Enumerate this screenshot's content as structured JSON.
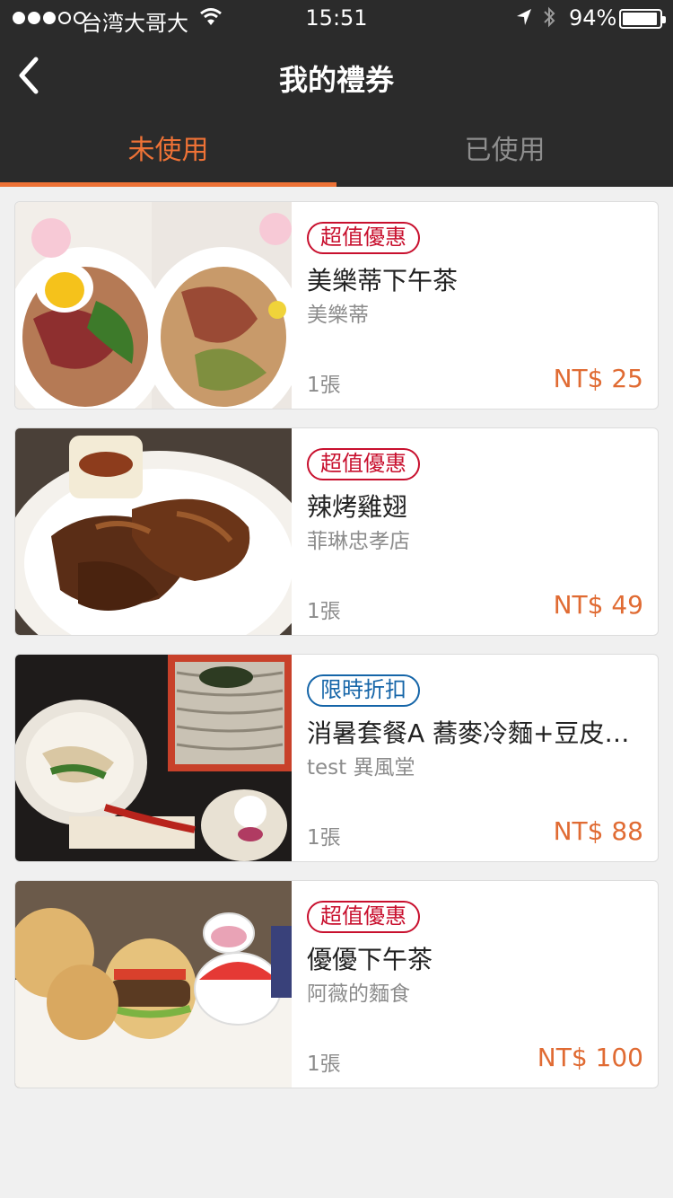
{
  "status_bar": {
    "carrier": "台湾大哥大",
    "time": "15:51",
    "battery_percent": "94%",
    "battery_level": 0.94,
    "signal_bars_filled": 3,
    "signal_bars_total": 5
  },
  "header": {
    "title": "我的禮券",
    "back_icon": "chevron-left-icon"
  },
  "tabs": [
    {
      "label": "未使用",
      "active": true
    },
    {
      "label": "已使用",
      "active": false
    }
  ],
  "colors": {
    "accent": "#ee7236",
    "header_bg": "#2b2b2b",
    "badge_red": "#c8102e",
    "badge_blue": "#1565a8",
    "price": "#e06b33"
  },
  "coupons": [
    {
      "badge": "超值優惠",
      "badge_color": "red",
      "title": "美樂蒂下午茶",
      "shop": "美樂蒂",
      "quantity": "1張",
      "price": "NT$ 25"
    },
    {
      "badge": "超值優惠",
      "badge_color": "red",
      "title": "辣烤雞翅",
      "shop": "菲琳忠孝店",
      "quantity": "1張",
      "price": "NT$ 49"
    },
    {
      "badge": "限時折扣",
      "badge_color": "blue",
      "title": "消暑套餐A 蕎麥冷麵+豆皮…",
      "shop": "test 異風堂",
      "quantity": "1張",
      "price": "NT$ 88"
    },
    {
      "badge": "超值優惠",
      "badge_color": "red",
      "title": "優優下午茶",
      "shop": "阿薇的麵食",
      "quantity": "1張",
      "price": "NT$ 100"
    }
  ]
}
